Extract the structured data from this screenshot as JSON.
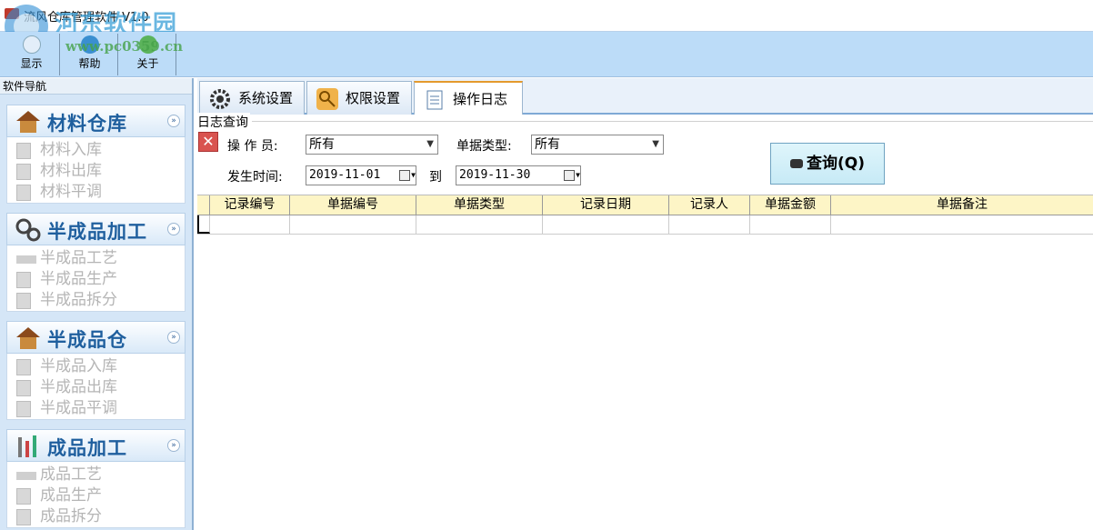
{
  "window": {
    "title": "流风仓库管理软件 V1.0",
    "watermark_text": "河东软件园",
    "watermark_url": "www.pc0359.cn"
  },
  "toolbar": {
    "buttons": [
      {
        "label": "显示"
      },
      {
        "label": "帮助"
      },
      {
        "label": "关于"
      }
    ]
  },
  "nav": {
    "title": "软件导航",
    "groups": [
      {
        "title": "材料仓库",
        "items": [
          "材料入库",
          "材料出库",
          "材料平调"
        ]
      },
      {
        "title": "半成品加工",
        "items": [
          "半成品工艺",
          "半成品生产",
          "半成品拆分"
        ]
      },
      {
        "title": "半成品仓",
        "items": [
          "半成品入库",
          "半成品出库",
          "半成品平调"
        ]
      },
      {
        "title": "成品加工",
        "items": [
          "成品工艺",
          "成品生产",
          "成品拆分"
        ]
      }
    ],
    "collapse_glyph": "»"
  },
  "tabs": [
    {
      "label": "系统设置"
    },
    {
      "label": "权限设置"
    },
    {
      "label": "操作日志"
    }
  ],
  "log_query": {
    "legend": "日志查询",
    "operator_label": "操 作 员:",
    "operator_value": "所有",
    "doc_type_label": "单据类型:",
    "doc_type_value": "所有",
    "time_label": "发生时间:",
    "date_from": "2019-11-01",
    "to_label": "到",
    "date_to": "2019-11-30",
    "query_button": "查询(Q)"
  },
  "grid": {
    "columns": [
      "记录编号",
      "单据编号",
      "单据类型",
      "记录日期",
      "记录人",
      "单据金额",
      "单据备注"
    ]
  },
  "colors": {
    "accent_tab": "#e49a2d",
    "header_blue": "#1f5f9e",
    "grid_header": "#fdf5c6"
  }
}
